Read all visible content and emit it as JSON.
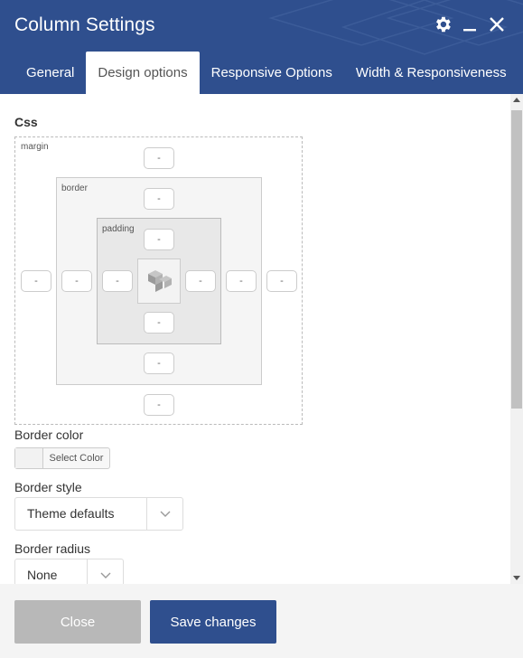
{
  "window": {
    "title": "Column Settings"
  },
  "header_icons": [
    "gear-icon",
    "minimize-icon",
    "close-icon"
  ],
  "tabs": [
    {
      "label": "General",
      "active": false
    },
    {
      "label": "Design options",
      "active": true
    },
    {
      "label": "Responsive Options",
      "active": false
    },
    {
      "label": "Width & Responsiveness",
      "active": false
    }
  ],
  "css": {
    "label": "Css",
    "margin_label": "margin",
    "border_label": "border",
    "padding_label": "padding",
    "margin": {
      "top": "-",
      "right": "-",
      "bottom": "-",
      "left": "-"
    },
    "border": {
      "top": "-",
      "right": "-",
      "bottom": "-",
      "left": "-"
    },
    "padding": {
      "top": "-",
      "right": "-",
      "bottom": "-",
      "left": "-"
    }
  },
  "border_color": {
    "label": "Border color",
    "button": "Select Color"
  },
  "border_style": {
    "label": "Border style",
    "value": "Theme defaults"
  },
  "border_radius": {
    "label": "Border radius",
    "value": "None"
  },
  "footer": {
    "close_label": "Close",
    "save_label": "Save changes"
  },
  "colors": {
    "header": "#2f4f8e",
    "save_button": "#2f4f8e",
    "close_button": "#b8b8b8"
  }
}
